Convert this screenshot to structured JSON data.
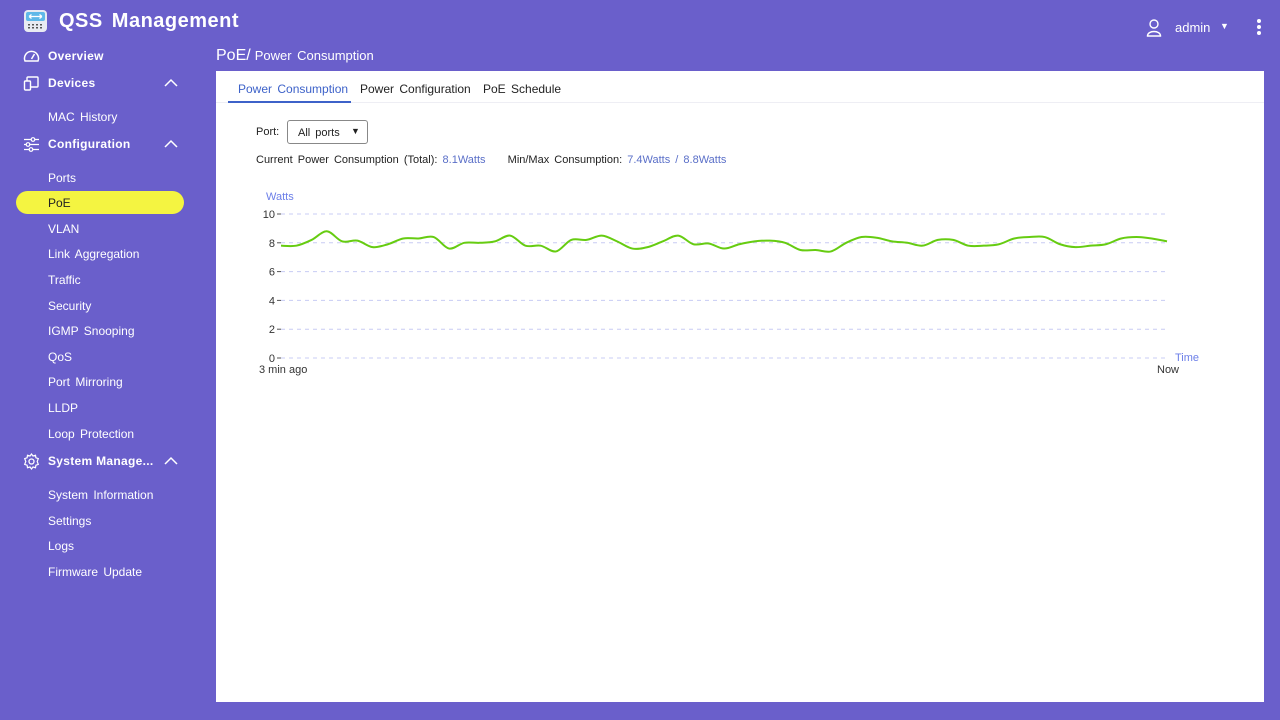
{
  "app": {
    "title": "QSS Management",
    "logo_icon": "switch-icon"
  },
  "user": {
    "icon": "user-icon",
    "name": "admin",
    "caret": "▼",
    "menu_icon": "kebab-menu-icon"
  },
  "sidebar": {
    "groups": [
      {
        "label": "Overview",
        "icon": "gauge-icon",
        "expandable": false
      },
      {
        "label": "Devices",
        "icon": "devices-icon",
        "expandable": true,
        "expanded": true,
        "items": [
          {
            "label": "MAC History"
          }
        ]
      },
      {
        "label": "Configuration",
        "icon": "sliders-icon",
        "expandable": true,
        "expanded": true,
        "items": [
          {
            "label": "Ports"
          },
          {
            "label": "PoE",
            "active": true
          },
          {
            "label": "VLAN"
          },
          {
            "label": "Link Aggregation"
          },
          {
            "label": "Traffic"
          },
          {
            "label": "Security"
          },
          {
            "label": "IGMP Snooping"
          },
          {
            "label": "QoS"
          },
          {
            "label": "Port Mirroring"
          },
          {
            "label": "LLDP"
          },
          {
            "label": "Loop Protection"
          }
        ]
      },
      {
        "label": "System Manage...",
        "icon": "gear-icon",
        "expandable": true,
        "expanded": true,
        "items": [
          {
            "label": "System Information"
          },
          {
            "label": "Settings"
          },
          {
            "label": "Logs"
          },
          {
            "label": "Firmware Update"
          }
        ]
      }
    ]
  },
  "breadcrumb": {
    "parent": "PoE/",
    "current": "Power Consumption"
  },
  "tabs": [
    {
      "label": "Power Consumption",
      "active": true
    },
    {
      "label": "Power Configuration",
      "active": false
    },
    {
      "label": "PoE Schedule",
      "active": false
    }
  ],
  "port_filter": {
    "label": "Port:",
    "value": "All ports",
    "caret": "▼"
  },
  "stats": {
    "current_label": "Current Power Consumption (Total):",
    "current_value": "8.1Watts",
    "minmax_label": "Min/Max Consumption:",
    "min_value": "7.4Watts",
    "separator": "/",
    "max_value": "8.8Watts"
  },
  "colors": {
    "brand_purple": "#6a5fcb",
    "active_item": "#f4f441",
    "accent_blue": "#3d62c9",
    "value_blue": "#5a6fc8",
    "line_green": "#66cc11",
    "grid_dash": "#c8ccf4"
  },
  "chart_data": {
    "type": "line",
    "title": "",
    "ylabel": "Watts",
    "xlabel": "Time",
    "ylim": [
      0,
      10
    ],
    "yticks": [
      0,
      2,
      4,
      6,
      8,
      10
    ],
    "xtick_labels": {
      "start": "3 min ago",
      "end": "Now"
    },
    "grid": true,
    "series": [
      {
        "name": "Power Consumption",
        "values": [
          7.8,
          7.8,
          8.2,
          8.8,
          8.1,
          8.15,
          7.7,
          7.9,
          8.3,
          8.3,
          8.4,
          7.6,
          8.0,
          8.0,
          8.1,
          8.5,
          7.8,
          7.8,
          7.4,
          8.2,
          8.2,
          8.5,
          8.1,
          7.6,
          7.7,
          8.1,
          8.5,
          7.9,
          7.95,
          7.6,
          7.9,
          8.1,
          8.15,
          8.0,
          7.5,
          7.5,
          7.4,
          8.0,
          8.4,
          8.35,
          8.1,
          8.0,
          7.8,
          8.2,
          8.2,
          7.8,
          7.8,
          7.9,
          8.3,
          8.4,
          8.4,
          7.9,
          7.7,
          7.8,
          7.9,
          8.3,
          8.4,
          8.3,
          8.1
        ]
      }
    ]
  }
}
